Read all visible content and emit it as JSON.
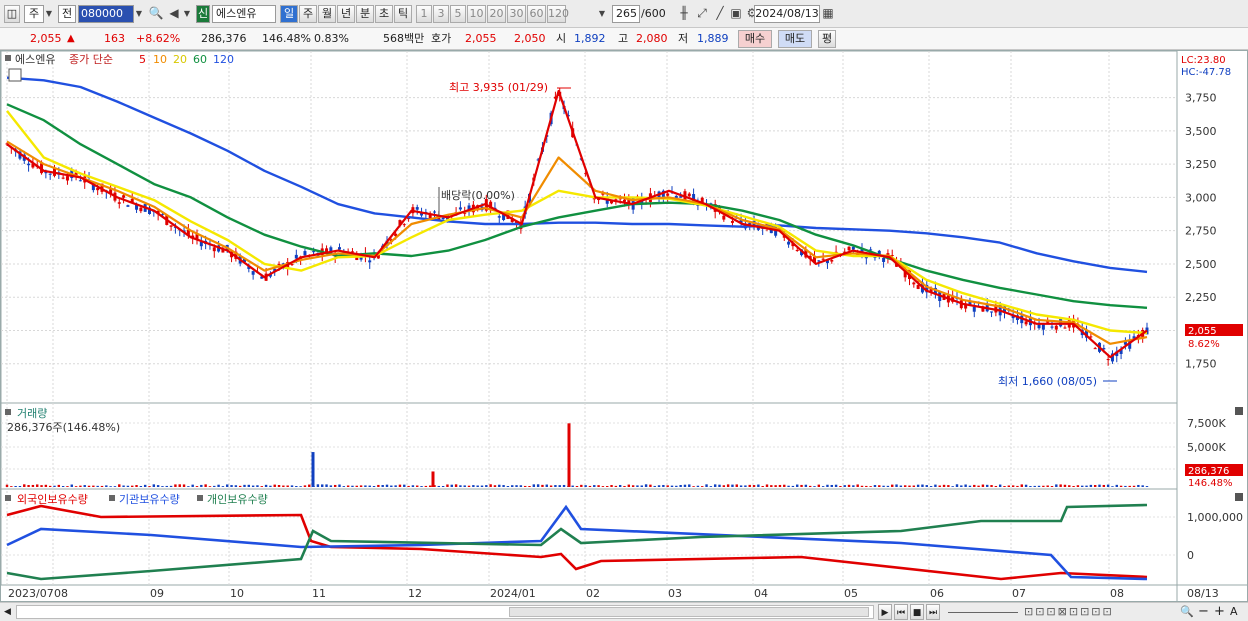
{
  "toolbar": {
    "period_type": "주",
    "compare": "전",
    "code": "080000",
    "stock_name": "에스엔유",
    "market_badge": "신",
    "periods": [
      "일",
      "주",
      "월",
      "년",
      "분",
      "초",
      "틱"
    ],
    "intervals": [
      "1",
      "3",
      "5",
      "10",
      "20",
      "30",
      "60",
      "120"
    ],
    "count": "265",
    "count_total": "/600",
    "date": "2024/08/13"
  },
  "quote": {
    "price": "2,055",
    "change": "163",
    "pct": "+8.62%",
    "volume": "286,376",
    "vol_ratio": "146.48%",
    "turnover": "0.83%",
    "value": "568백만",
    "ask_label": "호가",
    "ask1": "2,055",
    "ask2": "2,050",
    "open_label": "시",
    "open": "1,892",
    "high_label": "고",
    "high": "2,080",
    "low_label": "저",
    "low": "1,889",
    "buy": "매수",
    "sell": "매도",
    "avg": "평"
  },
  "panes": {
    "price_legend_name": "에스엔유",
    "price_legend_series": "종가 단순",
    "ma_periods": [
      "5",
      "10",
      "20",
      "60",
      "120"
    ],
    "lc": "LC:23.80",
    "hc": "HC:-47.78",
    "high_note": "최고 3,935 (01/29)",
    "low_note": "최저 1,660 (08/05)",
    "dividend_note": "배당락(0.00%)",
    "current_price_tag": "2,055",
    "current_pct_tag": "8.62%",
    "volume_title": "거래량",
    "volume_info": "286,376주(146.48%)",
    "volume_tag": "286,376",
    "volume_pct_tag": "146.48%",
    "holdings_legend": [
      "외국인보유수량",
      "기관보유수량",
      "개인보유수량"
    ]
  },
  "colors": {
    "up": "#e00000",
    "down": "#1040c0",
    "ma5": "#e00000",
    "ma10": "#f08c00",
    "ma20": "#f5e800",
    "ma60": "#109040",
    "ma120": "#2050e0"
  },
  "chart_data": [
    {
      "type": "line",
      "title": "에스엔유",
      "series": [
        {
          "name": "종가 단순 5",
          "values": [
            3400,
            3200,
            3150,
            3000,
            2900,
            2700,
            2600,
            2400,
            2550,
            2600,
            2550,
            2900,
            2850,
            2950,
            2800,
            3800,
            3000,
            2950,
            3050,
            2950,
            2800,
            2750,
            2500,
            2600,
            2550,
            2300,
            2200,
            2150,
            2050,
            2050,
            1800,
            2000
          ]
        },
        {
          "name": "10",
          "values": [
            3420,
            3250,
            3150,
            3050,
            2930,
            2750,
            2620,
            2450,
            2530,
            2580,
            2560,
            2800,
            2870,
            2920,
            2850,
            3300,
            3050,
            2980,
            3000,
            2950,
            2830,
            2760,
            2550,
            2580,
            2560,
            2330,
            2230,
            2180,
            2080,
            2060,
            1900,
            1950
          ]
        },
        {
          "name": "20",
          "values": [
            3650,
            3300,
            3180,
            3080,
            2980,
            2820,
            2680,
            2500,
            2450,
            2550,
            2560,
            2700,
            2830,
            2870,
            2900,
            3050,
            3000,
            3000,
            2990,
            2940,
            2860,
            2780,
            2600,
            2560,
            2560,
            2380,
            2280,
            2200,
            2120,
            2080,
            2000,
            1980
          ]
        },
        {
          "name": "60",
          "values": [
            3700,
            3580,
            3400,
            3250,
            3100,
            3000,
            2850,
            2720,
            2630,
            2560,
            2580,
            2560,
            2600,
            2680,
            2780,
            2850,
            2900,
            2950,
            2960,
            2950,
            2900,
            2830,
            2720,
            2640,
            2540,
            2450,
            2380,
            2320,
            2270,
            2220,
            2190,
            2170
          ]
        },
        {
          "name": "120",
          "values": [
            3900,
            3880,
            3830,
            3720,
            3600,
            3480,
            3350,
            3200,
            3080,
            2950,
            2880,
            2850,
            2820,
            2800,
            2800,
            2810,
            2810,
            2800,
            2800,
            2790,
            2780,
            2790,
            2770,
            2760,
            2750,
            2730,
            2700,
            2660,
            2580,
            2520,
            2470,
            2440
          ]
        }
      ],
      "categories": [
        "2023/07",
        "08",
        "09",
        "10",
        "11",
        "12",
        "2024/01",
        "02",
        "03",
        "04",
        "05",
        "06",
        "07",
        "08"
      ],
      "ylim": [
        1500,
        3950
      ],
      "yticks": [
        1750,
        2000,
        2250,
        2500,
        2750,
        3000,
        3250,
        3500,
        3750
      ]
    },
    {
      "type": "bar",
      "title": "거래량",
      "ylim": [
        0,
        8500000
      ],
      "yticks": [
        "2,500K",
        "5,000K",
        "7,500K"
      ],
      "spikes": [
        {
          "at": "11",
          "value": 4500000
        },
        {
          "at": "12",
          "value": 2000000
        },
        {
          "at": "2024/01",
          "value": 8200000
        }
      ]
    },
    {
      "type": "line",
      "series": [
        {
          "name": "외국인보유수량"
        },
        {
          "name": "기관보유수량"
        },
        {
          "name": "개인보유수량"
        }
      ],
      "yticks": [
        "0",
        "1,000,000"
      ]
    }
  ],
  "bottom": {
    "nav_buttons": [
      "▶",
      "⏮",
      "■",
      "⏭"
    ]
  }
}
